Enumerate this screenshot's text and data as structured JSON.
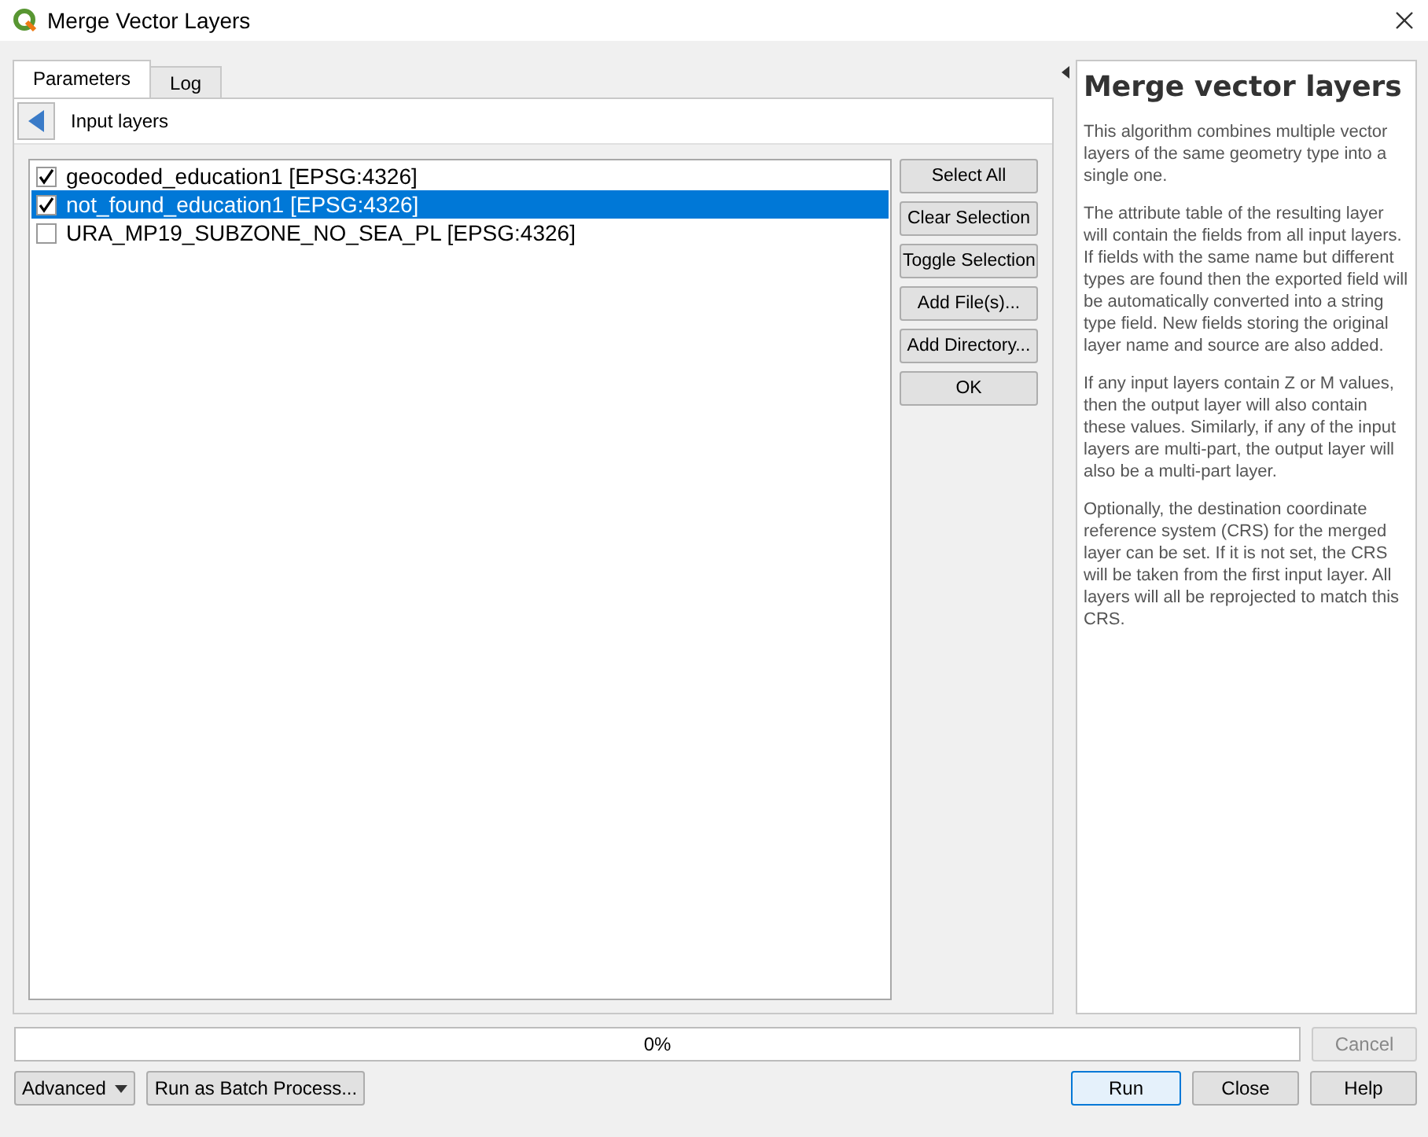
{
  "window": {
    "title": "Merge Vector Layers"
  },
  "tabs": [
    {
      "label": "Parameters",
      "selected": true
    },
    {
      "label": "Log",
      "selected": false
    }
  ],
  "panel": {
    "title": "Input layers"
  },
  "layers": [
    {
      "label": "geocoded_education1 [EPSG:4326]",
      "checked": true,
      "selected": false
    },
    {
      "label": "not_found_education1 [EPSG:4326]",
      "checked": true,
      "selected": true
    },
    {
      "label": "URA_MP19_SUBZONE_NO_SEA_PL [EPSG:4326]",
      "checked": false,
      "selected": false
    }
  ],
  "list_buttons": [
    "Select All",
    "Clear Selection",
    "Toggle Selection",
    "Add File(s)...",
    "Add Directory...",
    "OK"
  ],
  "help": {
    "title": "Merge vector layers",
    "paragraphs": [
      "This algorithm combines multiple vector layers of the same geometry type into a single one.",
      "The attribute table of the resulting layer will contain the fields from all input layers. If fields with the same name but different types are found then the exported field will be automatically converted into a string type field. New fields storing the original layer name and source are also added.",
      "If any input layers contain Z or M values, then the output layer will also contain these values. Similarly, if any of the input layers are multi-part, the output layer will also be a multi-part layer.",
      "Optionally, the destination coordinate reference system (CRS) for the merged layer can be set. If it is not set, the CRS will be taken from the first input layer. All layers will all be reprojected to match this CRS."
    ]
  },
  "progress": {
    "level": 0,
    "reading": "0%"
  },
  "cancel": {
    "label": "Cancel",
    "disabled": true
  },
  "advanced": {
    "label": "Advanced"
  },
  "batch": {
    "label": "Run as Batch Process..."
  },
  "actions": [
    {
      "label": "Run",
      "default": true
    },
    {
      "label": "Close",
      "default": false
    },
    {
      "label": "Help",
      "default": false
    }
  ]
}
